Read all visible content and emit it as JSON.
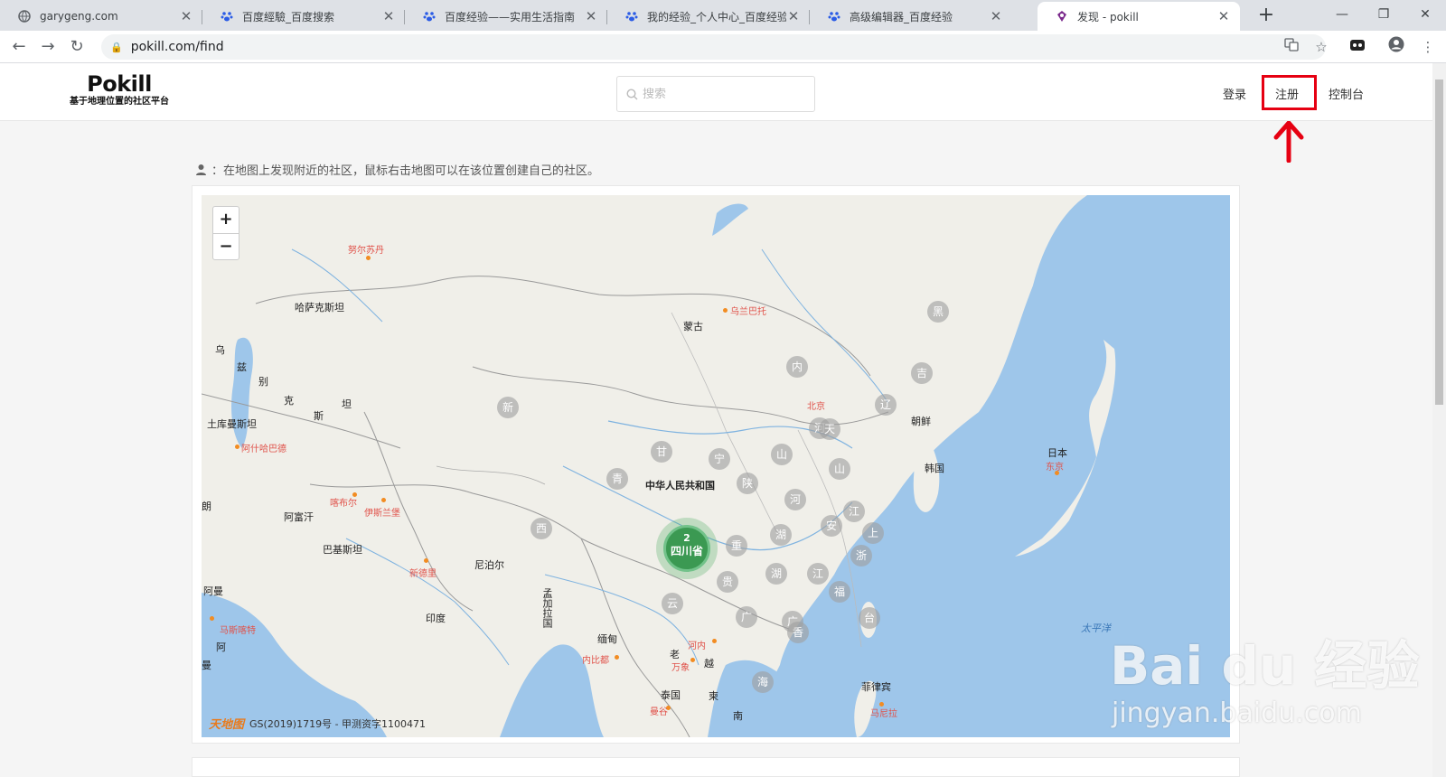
{
  "browser": {
    "tabs": [
      {
        "title": "garygeng.com",
        "icon": "globe-icon"
      },
      {
        "title": "百度經驗_百度搜索",
        "icon": "baidu-paw-icon"
      },
      {
        "title": "百度经验——实用生活指南",
        "icon": "baidu-paw-icon"
      },
      {
        "title": "我的经验_个人中心_百度经验",
        "icon": "baidu-paw-icon"
      },
      {
        "title": "高级编辑器_百度经验",
        "icon": "baidu-paw-icon"
      },
      {
        "title": "发现 - pokill",
        "icon": "pokill-icon"
      }
    ],
    "url": "pokill.com/find"
  },
  "header": {
    "logo_title": "Pokill",
    "logo_subtitle": "基于地理位置的社区平台",
    "search_placeholder": "搜索",
    "nav": {
      "login": "登录",
      "register": "注册",
      "console": "控制台"
    }
  },
  "annotation": {
    "color": "#e60012"
  },
  "hint": "：在地图上发现附近的社区，鼠标右击地图可以在该位置创建自己的社区。",
  "map": {
    "zoom_in": "+",
    "zoom_out": "−",
    "attribution": "GS(2019)1719号 - 甲测资字1100471",
    "attribution_logo": "天地图",
    "cluster": {
      "count": "2",
      "name": "四川省"
    },
    "labels": {
      "mongolia": "蒙古",
      "ulaanbaatar": "乌兰巴托",
      "kazakhstan": "哈萨克斯坦",
      "omsk": "努尔苏丹",
      "turkmenistan": "土库曼斯坦",
      "ashgabat": "阿什哈巴德",
      "afghanistan": "阿富汗",
      "kabul": "喀布尔",
      "islamabad": "伊斯兰堡",
      "pakistan": "巴基斯坦",
      "newdelhi": "新德里",
      "nepal": "尼泊尔",
      "india": "印度",
      "china": "中华人民共和国",
      "myanmar": "缅甸",
      "naypyidaw": "内比都",
      "thailand": "泰国",
      "bangkok": "曼谷",
      "laos": "老",
      "vientiane": "万象",
      "vietnam": "越",
      "hanoi": "河内",
      "cambodia": "柬",
      "south": "南",
      "philippines": "菲律宾",
      "manila": "马尼拉",
      "japan": "日本",
      "tokyo": "东京",
      "korea": "韩国",
      "dprk": "朝鲜",
      "beijing": "北京",
      "pacific": "太平洋",
      "oman": "阿曼",
      "muscat": "马斯喀特",
      "bangladesh": "孟加拉国",
      "uz1": "乌",
      "uz2": "兹",
      "uz3": "别",
      "uz4": "克",
      "uz5": "斯",
      "uz6": "坦",
      "left_a": "阿",
      "left_b": "曼",
      "left_c": "朗"
    },
    "provinces": [
      "新",
      "内",
      "黑",
      "吉",
      "辽",
      "河",
      "天",
      "甘",
      "宁",
      "山",
      "山",
      "青",
      "陕",
      "河",
      "江",
      "上",
      "安",
      "湖",
      "浙",
      "西",
      "重",
      "湖",
      "江",
      "福",
      "贵",
      "云",
      "广",
      "广",
      "香",
      "台",
      "海"
    ]
  },
  "watermark": {
    "main": "Bai du 经验",
    "sub": "jingyan.baidu.com"
  }
}
